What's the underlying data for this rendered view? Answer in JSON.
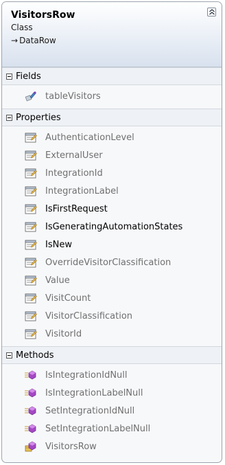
{
  "class": {
    "name": "VisitorsRow",
    "kind": "Class",
    "base": "DataRow",
    "base_arrow": "→"
  },
  "sections": {
    "fields": {
      "title": "Fields",
      "items": [
        {
          "label": "tableVisitors",
          "icon": "field-icon"
        }
      ]
    },
    "properties": {
      "title": "Properties",
      "items": [
        {
          "label": "AuthenticationLevel",
          "icon": "property-icon"
        },
        {
          "label": "ExternalUser",
          "icon": "property-icon"
        },
        {
          "label": "IntegrationId",
          "icon": "property-icon"
        },
        {
          "label": "IntegrationLabel",
          "icon": "property-icon"
        },
        {
          "label": "IsFirstRequest",
          "icon": "property-icon"
        },
        {
          "label": "IsGeneratingAutomationStates",
          "icon": "property-icon"
        },
        {
          "label": "IsNew",
          "icon": "property-icon"
        },
        {
          "label": "OverrideVisitorClassification",
          "icon": "property-icon"
        },
        {
          "label": "Value",
          "icon": "property-icon"
        },
        {
          "label": "VisitCount",
          "icon": "property-icon"
        },
        {
          "label": "VisitorClassification",
          "icon": "property-icon"
        },
        {
          "label": "VisitorId",
          "icon": "property-icon"
        }
      ]
    },
    "methods": {
      "title": "Methods",
      "items": [
        {
          "label": "IsIntegrationIdNull",
          "icon": "method-icon"
        },
        {
          "label": "IsIntegrationLabelNull",
          "icon": "method-icon"
        },
        {
          "label": "SetIntegrationIdNull",
          "icon": "method-icon"
        },
        {
          "label": "SetIntegrationLabelNull",
          "icon": "method-icon"
        },
        {
          "label": "VisitorsRow",
          "icon": "constructor-icon"
        }
      ]
    }
  },
  "colors": {
    "border": "#9aa3ad",
    "header_gradient_end": "#d8e1ee",
    "muted_text": "#6f6f6f",
    "method_purple": "#9b3fb5"
  }
}
